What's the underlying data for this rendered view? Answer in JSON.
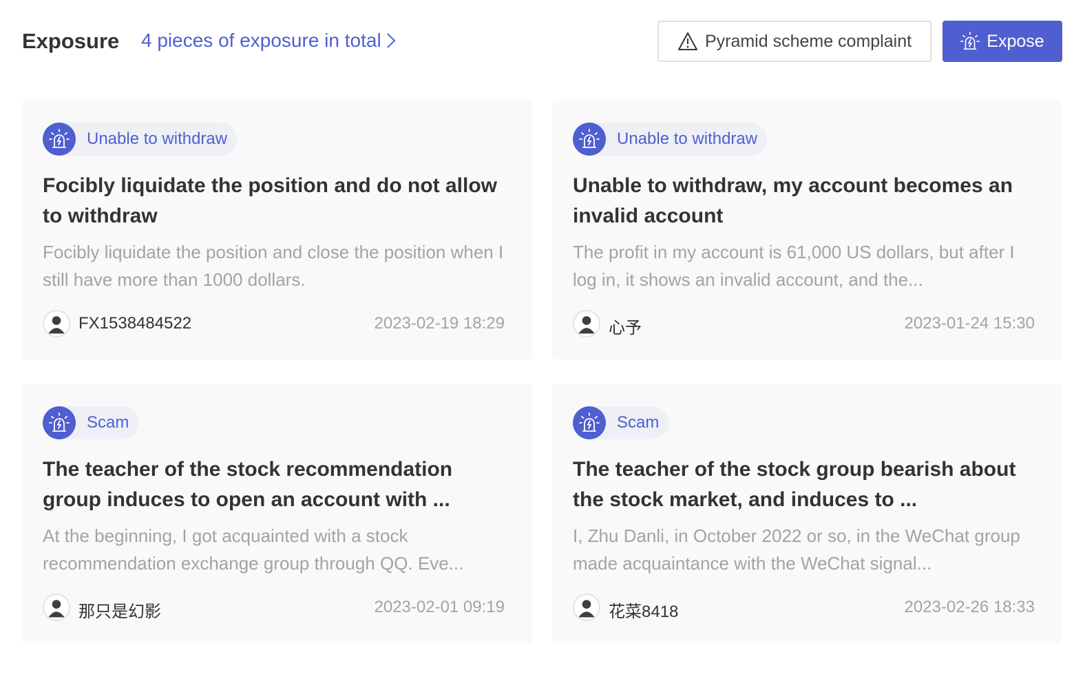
{
  "header": {
    "title": "Exposure",
    "total_link": "4 pieces of exposure in total",
    "complaint_button": "Pyramid scheme complaint",
    "expose_button": "Expose"
  },
  "colors": {
    "accent": "#4f5fd0",
    "card_bg": "#f9f9fa",
    "muted_text": "#a3a3a3"
  },
  "cards": [
    {
      "tag": "Unable to withdraw",
      "title": "Focibly liquidate the position and do not allow to withdraw",
      "description": "Focibly liquidate the position and close the position when I still have more than 1000 dollars.",
      "author": "FX1538484522",
      "time": "2023-02-19 18:29"
    },
    {
      "tag": "Unable to withdraw",
      "title": "Unable to withdraw, my account becomes an invalid account",
      "description": "The profit in my account is 61,000 US dollars, but after I log in, it shows an invalid account, and the...",
      "author": "心予",
      "time": "2023-01-24 15:30"
    },
    {
      "tag": "Scam",
      "title": "The teacher of the stock recommendation group induces to open an account with ...",
      "description": "At the beginning, I got acquainted with a stock recommendation exchange group through QQ. Eve...",
      "author": "那只是幻影",
      "time": "2023-02-01 09:19"
    },
    {
      "tag": "Scam",
      "title": "The teacher of the stock group bearish about the stock market, and induces to ...",
      "description": "I, Zhu Danli, in October 2022 or so, in the WeChat group made acquaintance with the WeChat signal...",
      "author": "花菜8418",
      "time": "2023-02-26 18:33"
    }
  ]
}
